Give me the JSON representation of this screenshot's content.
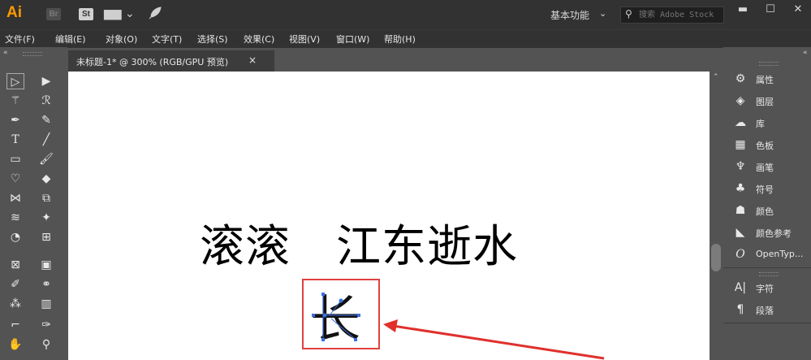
{
  "titlebar": {
    "app_logo": "Ai",
    "badge_br": "Br",
    "badge_st": "St",
    "workspace": "基本功能",
    "search_placeholder": "搜索 Adobe Stock"
  },
  "menu": [
    "文件(F)",
    "编辑(E)",
    "对象(O)",
    "文字(T)",
    "选择(S)",
    "效果(C)",
    "视图(V)",
    "窗口(W)",
    "帮助(H)"
  ],
  "document": {
    "tab_title": "未标题-1* @ 300% (RGB/GPU 预览)",
    "tab_close": "×"
  },
  "canvas": {
    "main_text": "滚滚　江东逝水",
    "selected_char": "长"
  },
  "right_panel": {
    "items": [
      "属性",
      "图层",
      "库",
      "色板",
      "画笔",
      "符号",
      "颜色",
      "颜色参考",
      "OpenTyp...",
      "字符",
      "段落"
    ]
  },
  "colors": {
    "accent_orange": "#ff9a00",
    "highlight_red": "#e04040",
    "path_blue": "#3b6fe0"
  }
}
